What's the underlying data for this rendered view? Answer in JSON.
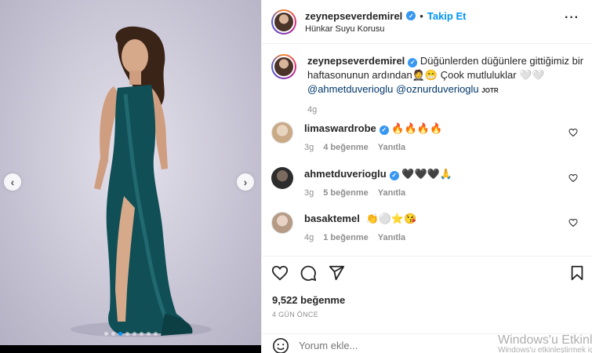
{
  "post": {
    "media_alt": "",
    "image_count": 8,
    "active_image": 3
  },
  "header": {
    "username": "zeynepseverdemirel",
    "separator": "•",
    "follow_label": "Takip Et",
    "location": "Hünkar Suyu Korusu",
    "more_icon": "more-options-icon"
  },
  "caption": {
    "username": "zeynepseverdemirel",
    "text": "Düğünlerden düğünlere gittiğimiz bir haftasonunun ardından🤵😁 Çook mutluluklar 🤍🤍",
    "mention1": "@ahmetduverioglu",
    "mention2": "@oznurduverioglu",
    "suffix": "JOTR",
    "age": "4g"
  },
  "comments": [
    {
      "username": "limaswardrobe",
      "text": "🔥🔥🔥🔥",
      "age": "3g",
      "likes": "4 beğenme",
      "reply": "Yanıtla"
    },
    {
      "username": "ahmetduverioglu",
      "text": "🖤🖤🖤🙏",
      "age": "3g",
      "likes": "5 beğenme",
      "reply": "Yanıtla"
    },
    {
      "username": "basaktemel",
      "text": "👏⚪⭐😘",
      "age": "4g",
      "likes": "1 beğenme",
      "reply": "Yanıtla"
    }
  ],
  "actions": {
    "like_count": "9,522 beğenme",
    "posted": "4 GÜN ÖNCE",
    "comment_placeholder": "Yorum ekle..."
  },
  "watermark": {
    "line1": "Windows'u Etkinl",
    "line2": "Windows'u etkinleştirmek için Ayarlar'a gidin."
  },
  "colors": {
    "accent": "#0095f6",
    "verified": "#3897f0",
    "dress": "#0f4f55"
  }
}
